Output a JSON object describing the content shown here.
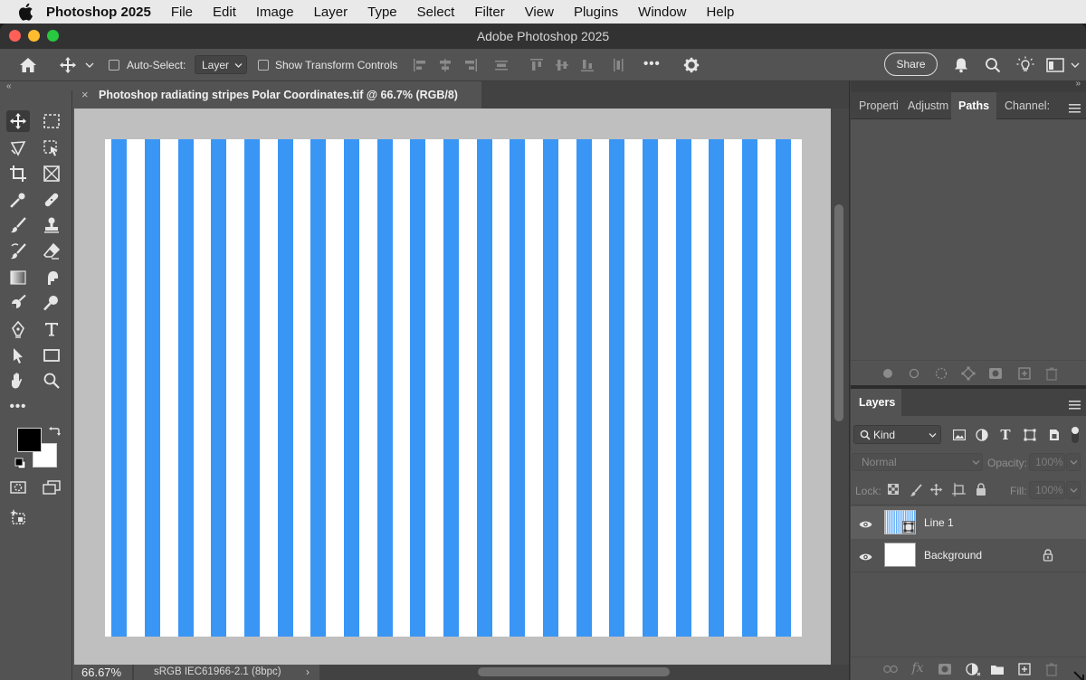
{
  "menubar": {
    "app_name": "Photoshop 2025",
    "items": [
      "File",
      "Edit",
      "Image",
      "Layer",
      "Type",
      "Select",
      "Filter",
      "View",
      "Plugins",
      "Window",
      "Help"
    ]
  },
  "window": {
    "title": "Adobe Photoshop 2025"
  },
  "options_bar": {
    "auto_select_label": "Auto-Select:",
    "auto_select_value": "Layer",
    "show_transform_label": "Show Transform Controls",
    "more_label": "•••",
    "share_label": "Share"
  },
  "document": {
    "tab_close": "×",
    "tab_title": "Photoshop radiating stripes Polar Coordinates.tif @ 66.7% (RGB/8)",
    "stripe_count": 21,
    "stripe_color": "#3a96f5",
    "background_color": "#ffffff"
  },
  "status_bar": {
    "zoom": "66.67%",
    "color_profile": "sRGB IEC61966-2.1 (8bpc)",
    "chevron": "›"
  },
  "toolbar": {
    "more_label": "•••",
    "foreground_color": "#000000",
    "background_color": "#ffffff"
  },
  "panels": {
    "top_tabs": [
      {
        "label": "Properti",
        "active": false
      },
      {
        "label": "Adjustm",
        "active": false
      },
      {
        "label": "Paths",
        "active": true
      },
      {
        "label": "Channel:",
        "active": false
      }
    ],
    "layers_tab": "Layers",
    "filter_kind": "Kind",
    "blend_mode": "Normal",
    "opacity_label": "Opacity:",
    "opacity_value": "100%",
    "lock_label": "Lock:",
    "fill_label": "Fill:",
    "fill_value": "100%",
    "layers": [
      {
        "name": "Line 1",
        "visible": true,
        "selected": true,
        "locked": false
      },
      {
        "name": "Background",
        "visible": true,
        "selected": false,
        "locked": true
      }
    ]
  },
  "colors": {
    "accent_blue": "#3a96f5",
    "panel_bg": "#535353",
    "dark_bg": "#424242"
  }
}
